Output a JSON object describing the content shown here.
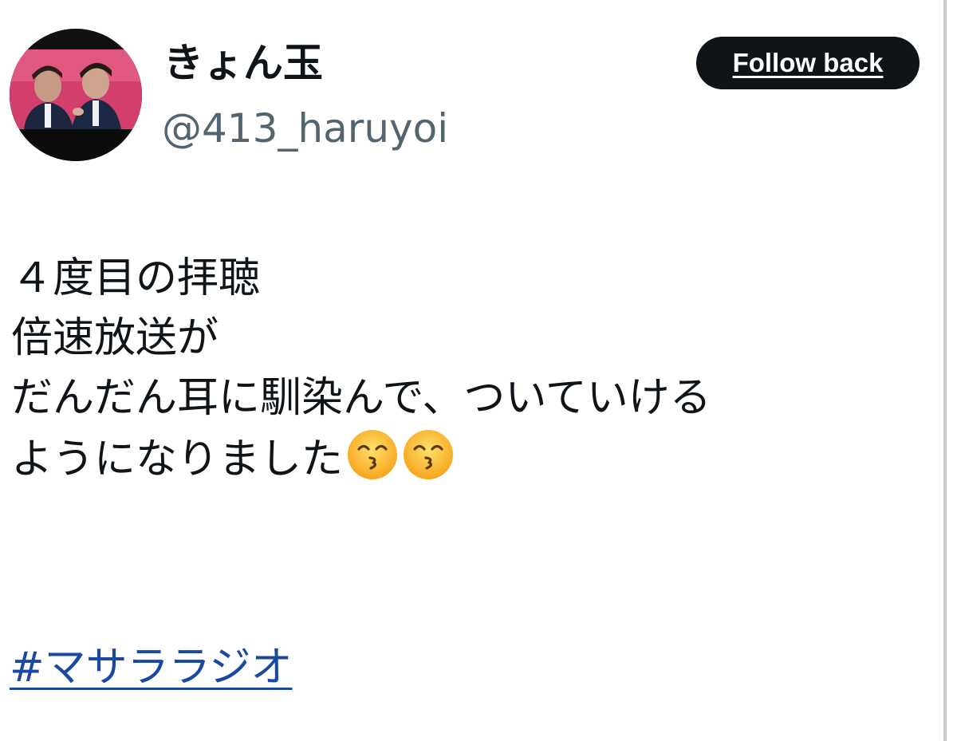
{
  "author": {
    "display_name": "きょん玉",
    "handle": "@413_haruyoi",
    "avatar_description": "profile-photo"
  },
  "actions": {
    "follow_label": "Follow back"
  },
  "tweet": {
    "lines": [
      "４度目の拝聴",
      "倍速放送が",
      "だんだん耳に馴染んで、ついていける",
      "ようになりました"
    ],
    "emoji_count": 2,
    "emoji_name": "kissing-face-with-smiling-eyes",
    "hashtag": "#マサララジオ"
  },
  "colors": {
    "text": "#0f1419",
    "handle": "#536471",
    "button_bg": "#0f1419",
    "link": "#1a4aa0"
  }
}
